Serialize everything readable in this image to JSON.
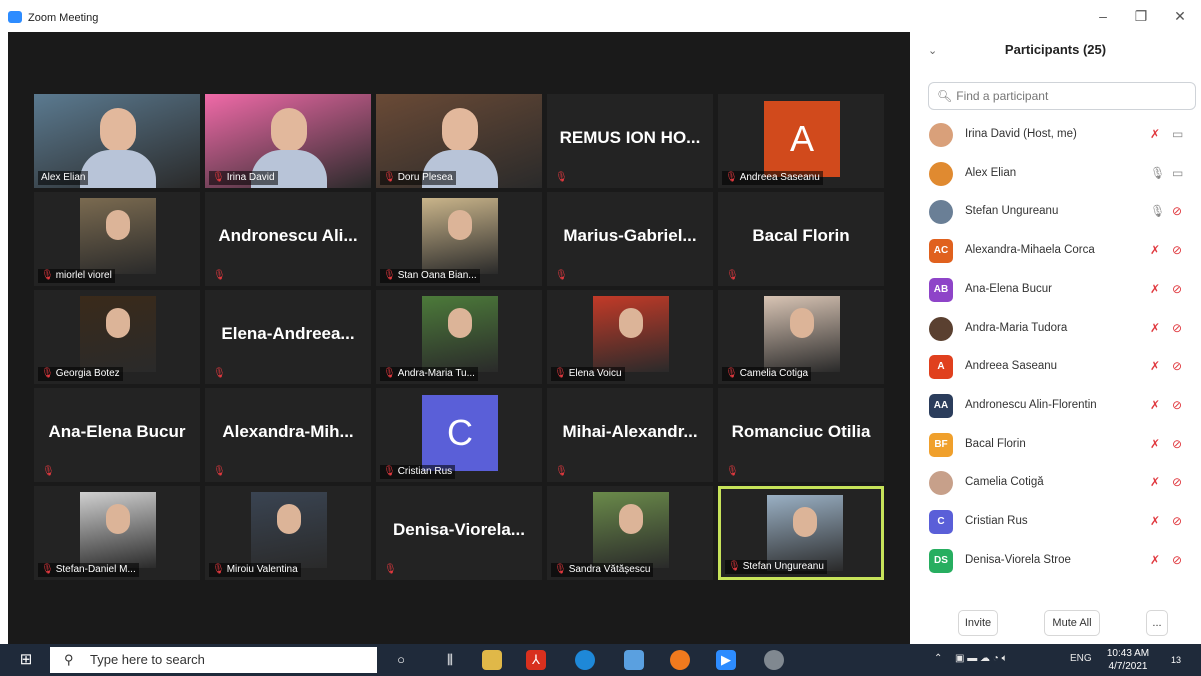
{
  "window": {
    "title": "Zoom Meeting",
    "minimize": "–",
    "maximize": "❐",
    "close": "✕"
  },
  "gallery": [
    {
      "label": "Alex Elian",
      "type": "video",
      "img": "man-glasses",
      "bg": "#5b7a90"
    },
    {
      "label": "Irina David",
      "type": "video",
      "img": "woman-pink",
      "bg": "#f06aa8"
    },
    {
      "label": "Doru Plesea",
      "type": "video",
      "img": "man-room",
      "bg": "#6a4a36"
    },
    {
      "display": "REMUS ION HO...",
      "type": "name"
    },
    {
      "label": "Andreea Saseanu",
      "type": "letter",
      "letter": "A",
      "color": "#d14a1c"
    },
    {
      "label": "miorlel viorel",
      "type": "photo",
      "img": "man-glasses2",
      "bg": "#7a6a50"
    },
    {
      "display": "Andronescu Ali...",
      "type": "name"
    },
    {
      "label": "Stan Oana Bian...",
      "type": "photo",
      "img": "dark-diagonal",
      "bg": "#c9b48a"
    },
    {
      "display": "Marius-Gabriel...",
      "type": "name"
    },
    {
      "display": "Bacal Florin",
      "type": "name"
    },
    {
      "label": "Georgia Botez",
      "type": "photo",
      "img": "dark-portrait",
      "bg": "#3a2a1a"
    },
    {
      "display": "Elena-Andreea...",
      "type": "name"
    },
    {
      "label": "Andra-Maria Tu...",
      "type": "photo",
      "img": "woman-green",
      "bg": "#4c7a3a"
    },
    {
      "label": "Elena Voicu",
      "type": "photo",
      "img": "woman-red",
      "bg": "#c23a28"
    },
    {
      "label": "Camelia Cotiga",
      "type": "photo",
      "img": "woman-light",
      "bg": "#d8c4b4"
    },
    {
      "display": "Ana-Elena Bucur",
      "type": "name"
    },
    {
      "display": "Alexandra-Mih...",
      "type": "name"
    },
    {
      "label": "Cristian Rus",
      "type": "letter",
      "letter": "C",
      "color": "#5a5fd8"
    },
    {
      "display": "Mihai-Alexandr...",
      "type": "name"
    },
    {
      "display": "Romanciuc Otilia",
      "type": "name"
    },
    {
      "label": "Stefan-Daniel M...",
      "type": "photo",
      "img": "man-bw",
      "bg": "#d0d0d0"
    },
    {
      "label": "Miroiu Valentina",
      "type": "photo",
      "img": "woman-dark",
      "bg": "#3a4452"
    },
    {
      "display": "Denisa-Viorela...",
      "type": "name"
    },
    {
      "label": "Sandra Vătășescu",
      "type": "photo",
      "img": "woman-outdoor",
      "bg": "#6a8a4a"
    },
    {
      "label": "Stefan Ungureanu",
      "type": "photo",
      "img": "man-suit",
      "bg": "#9ab0c4",
      "active": true
    }
  ],
  "participants": {
    "title": "Participants (25)",
    "search_placeholder": "Find a participant",
    "items": [
      {
        "name": "Irina David (Host, me)",
        "avatar": "photo",
        "color": "#d9a07a",
        "mic": "muted",
        "cam": "on"
      },
      {
        "name": "Alex Elian",
        "avatar": "photo",
        "color": "#e08a30",
        "mic": "on",
        "cam": "on"
      },
      {
        "name": "Stefan Ungureanu",
        "avatar": "photo",
        "color": "#6a7f96",
        "mic": "on",
        "cam": "off"
      },
      {
        "name": "Alexandra-Mihaela Corca",
        "avatar": "AC",
        "color": "#e0611e",
        "mic": "muted",
        "cam": "off"
      },
      {
        "name": "Ana-Elena Bucur",
        "avatar": "AB",
        "color": "#8e44c8",
        "mic": "muted",
        "cam": "off"
      },
      {
        "name": "Andra-Maria Tudora",
        "avatar": "photo",
        "color": "#5a4030",
        "mic": "muted",
        "cam": "off"
      },
      {
        "name": "Andreea Saseanu",
        "avatar": "A",
        "color": "#e0401e",
        "mic": "muted",
        "cam": "off"
      },
      {
        "name": "Andronescu Alin-Florentin",
        "avatar": "AA",
        "color": "#2b3d5c",
        "mic": "muted",
        "cam": "off"
      },
      {
        "name": "Bacal Florin",
        "avatar": "BF",
        "color": "#f0a02c",
        "mic": "muted",
        "cam": "off"
      },
      {
        "name": "Camelia Cotigă",
        "avatar": "photo",
        "color": "#c7a08a",
        "mic": "muted",
        "cam": "off"
      },
      {
        "name": "Cristian Rus",
        "avatar": "C",
        "color": "#5a5fd8",
        "mic": "muted",
        "cam": "off"
      },
      {
        "name": "Denisa-Viorela Stroe",
        "avatar": "DS",
        "color": "#27ae60",
        "mic": "muted",
        "cam": "off"
      }
    ],
    "invite_label": "Invite",
    "mute_all_label": "Mute All",
    "more_label": "..."
  },
  "taskbar": {
    "search_placeholder": "Type here to search",
    "lang": "ENG",
    "time": "10:43 AM",
    "date": "4/7/2021",
    "notifications": "13"
  }
}
